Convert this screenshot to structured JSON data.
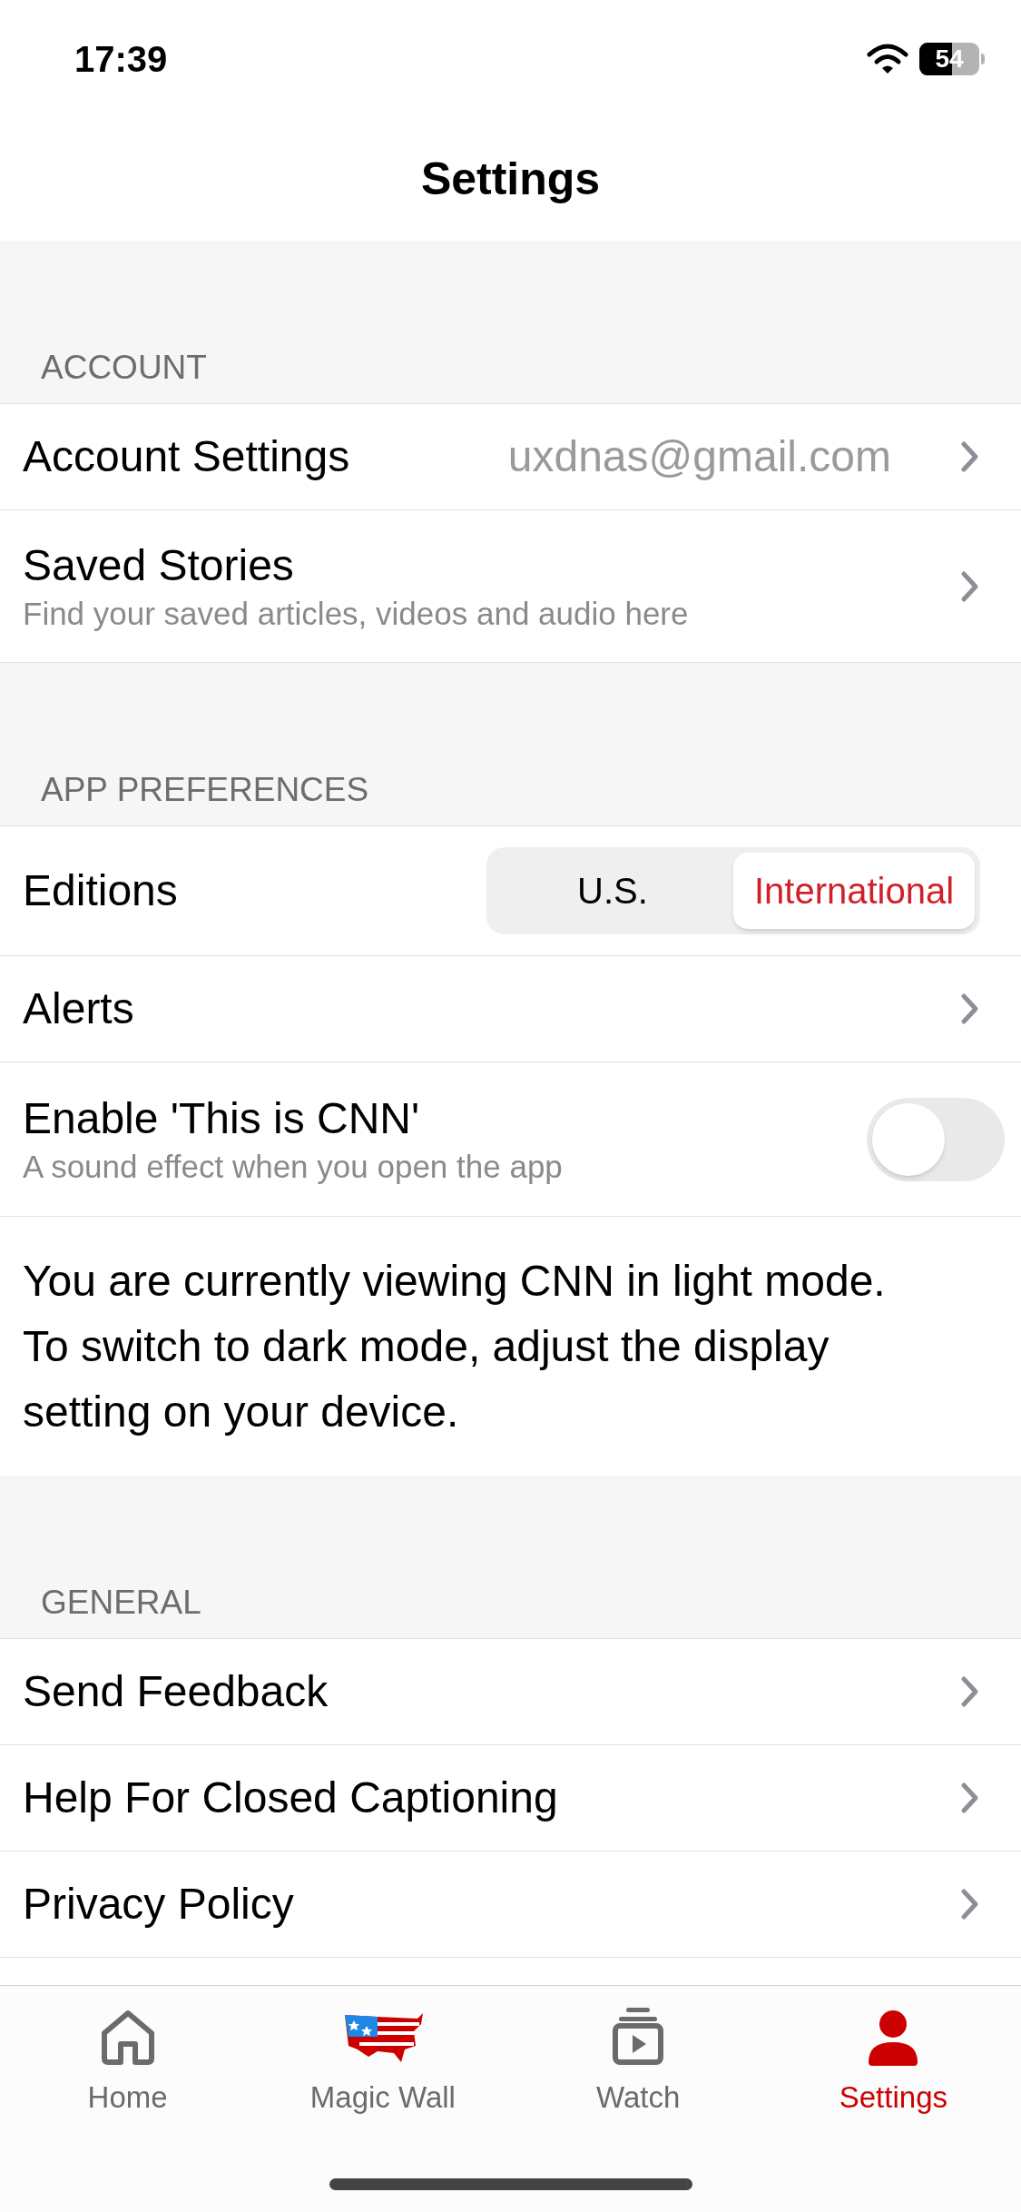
{
  "status_bar": {
    "time": "17:39",
    "battery": "54"
  },
  "header": {
    "title": "Settings"
  },
  "sections": [
    {
      "title": "ACCOUNT",
      "rows": [
        {
          "kind": "link",
          "label": "Account Settings",
          "value": "uxdnas@gmail.com"
        },
        {
          "kind": "link",
          "label": "Saved Stories",
          "subtitle": "Find your saved articles, videos and audio here"
        }
      ]
    },
    {
      "title": "APP PREFERENCES",
      "rows": [
        {
          "kind": "segmented",
          "label": "Editions",
          "options": [
            {
              "label": "U.S.",
              "selected": false
            },
            {
              "label": "International",
              "selected": true
            }
          ]
        },
        {
          "kind": "link",
          "label": "Alerts"
        },
        {
          "kind": "toggle",
          "label": "Enable 'This is CNN'",
          "subtitle": "A sound effect when you open the app",
          "on": false
        },
        {
          "kind": "note",
          "label": "You are currently viewing CNN in light mode. To switch to dark mode, adjust the display setting on your device."
        }
      ]
    },
    {
      "title": "GENERAL",
      "rows": [
        {
          "kind": "link",
          "label": "Send Feedback"
        },
        {
          "kind": "link",
          "label": "Help For Closed Captioning"
        },
        {
          "kind": "link",
          "label": "Privacy Policy"
        }
      ]
    }
  ],
  "tab_bar": [
    {
      "kind": "home",
      "label": "Home",
      "selected": false
    },
    {
      "kind": "map",
      "label": "Magic Wall",
      "selected": false
    },
    {
      "kind": "watch",
      "label": "Watch",
      "selected": false
    },
    {
      "kind": "person",
      "label": "Settings",
      "selected": true
    }
  ]
}
